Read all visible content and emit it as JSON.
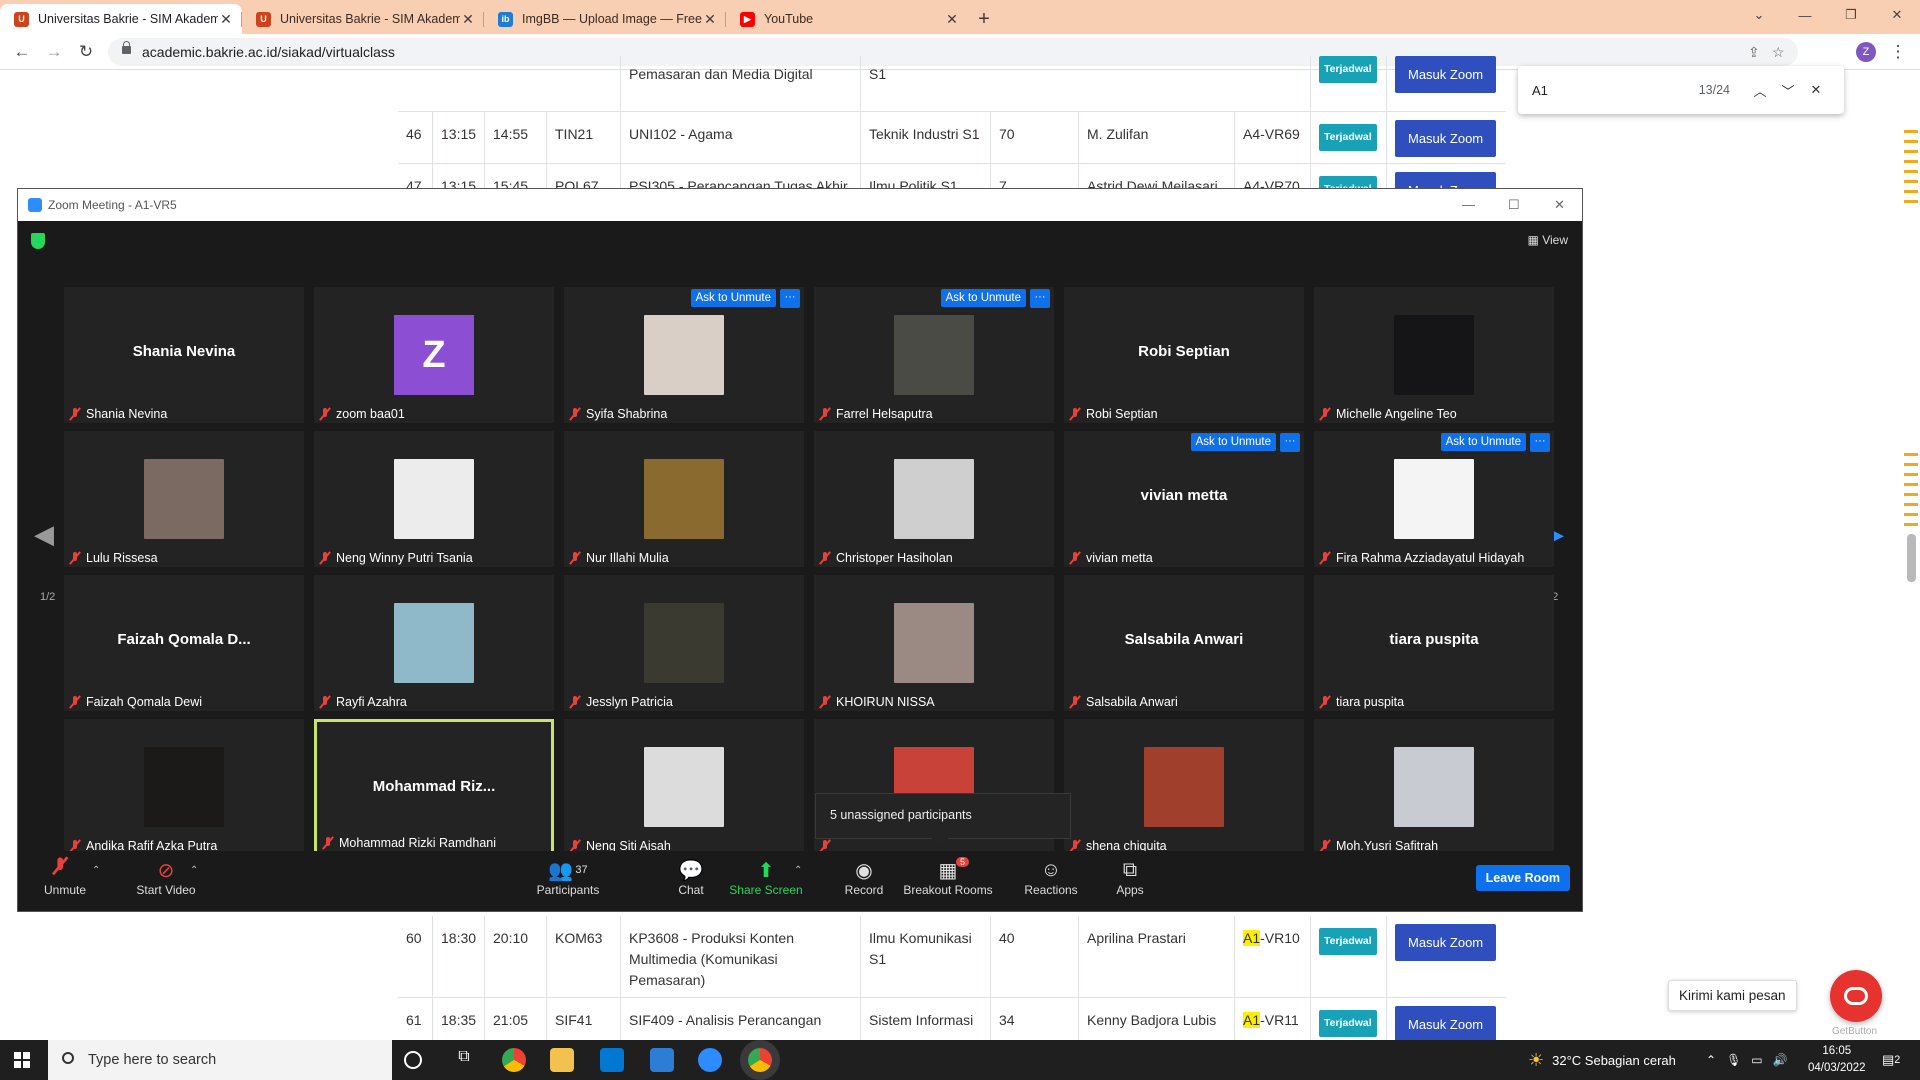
{
  "browser": {
    "tabs": [
      {
        "title": "Universitas Bakrie - SIM Akadem",
        "active": true
      },
      {
        "title": "Universitas Bakrie - SIM Akadem",
        "active": false
      },
      {
        "title": "ImgBB — Upload Image — Free",
        "active": false
      },
      {
        "title": "YouTube",
        "active": false
      }
    ],
    "url": "academic.bakrie.ac.id/siakad/virtualclass",
    "profile_initial": "Z"
  },
  "find": {
    "query": "A1",
    "count": "13/24"
  },
  "table": {
    "rows_top": [
      {
        "no": "46",
        "start": "13:15",
        "end": "14:55",
        "code": "TIN21",
        "course": "UNI102 - Agama",
        "prodi": "Teknik Industri S1",
        "qty": "70",
        "lecturer": "M. Zulifan",
        "room": "A4-VR69",
        "status": "Terjadwal",
        "action": "Masuk Zoom"
      },
      {
        "no": "47",
        "start": "13:15",
        "end": "15:45",
        "code": "POL67",
        "course": "PSI305 - Perancangan Tugas Akhir",
        "prodi": "Ilmu Politik S1",
        "qty": "7",
        "lecturer": "Astrid Dewi Meilasari",
        "room": "A4-VR70",
        "status": "Terjadwal",
        "action": "Masuk Zoom"
      }
    ],
    "partial_top": {
      "course_line2": "Pemasaran dan Media Digital",
      "prodi_line2": "S1",
      "action": "Masuk Zoom",
      "status": "Terjadwal"
    },
    "rows_bottom": [
      {
        "no": "60",
        "start": "18:30",
        "end": "20:10",
        "code": "KOM63",
        "course": "KP3608 - Produksi Konten Multimedia (Komunikasi Pemasaran)",
        "prodi": "Ilmu Komunikasi S1",
        "qty": "40",
        "lecturer": "Aprilina Prastari",
        "room_hl": "A1",
        "room_rest": "-VR10",
        "status": "Terjadwal",
        "action": "Masuk Zoom"
      },
      {
        "no": "61",
        "start": "18:35",
        "end": "21:05",
        "code": "SIF41",
        "course": "SIF409 - Analisis Perancangan",
        "prodi": "Sistem Informasi",
        "qty": "34",
        "lecturer": "Kenny Badjora Lubis",
        "room_hl": "A1",
        "room_rest": "-VR11",
        "status": "Terjadwal",
        "action": "Masuk Zoom"
      }
    ]
  },
  "zoom": {
    "title": "Zoom Meeting - A1-VR5",
    "view_label": "View",
    "ask_to_unmute": "Ask to Unmute",
    "more": "···",
    "page_indicator": "1/2",
    "participants": [
      {
        "name": "Shania Nevina",
        "display": "Shania Nevina",
        "kind": "text"
      },
      {
        "name": "zoom baa01",
        "display": "Z",
        "kind": "avatar"
      },
      {
        "name": "Syifa Shabrina",
        "kind": "photo",
        "color": "#d9cfc6",
        "ask": true
      },
      {
        "name": "Farrel Helsaputra",
        "kind": "photo",
        "color": "#4b4b46",
        "ask": true
      },
      {
        "name": "Robi Septian",
        "display": "Robi Septian",
        "kind": "text"
      },
      {
        "name": "Michelle Angeline Teo",
        "kind": "photo",
        "color": "#151517"
      },
      {
        "name": "Lulu Rissesa",
        "kind": "photo",
        "color": "#7a6a62"
      },
      {
        "name": "Neng Winny Putri Tsania",
        "kind": "photo",
        "color": "#ececec"
      },
      {
        "name": "Nur Illahi Mulia",
        "kind": "photo",
        "color": "#8a6a2f"
      },
      {
        "name": "Christoper Hasiholan",
        "kind": "photo",
        "color": "#cfcfcf"
      },
      {
        "name": "vivian metta",
        "display": "vivian metta",
        "kind": "text",
        "ask": true
      },
      {
        "name": "Fira Rahma Azziadayatul Hidayah",
        "kind": "photo",
        "color": "#f4f4f4",
        "ask": true
      },
      {
        "name": "Faizah Qomala Dewi",
        "display": "Faizah Qomala D...",
        "kind": "text"
      },
      {
        "name": "Rayfi Azahra",
        "kind": "photo",
        "color": "#8fb8c9"
      },
      {
        "name": "Jesslyn Patricia",
        "kind": "photo",
        "color": "#3a3a30"
      },
      {
        "name": "KHOIRUN NISSA",
        "kind": "photo",
        "color": "#9a8a83"
      },
      {
        "name": "Salsabila Anwari",
        "display": "Salsabila Anwari",
        "kind": "text"
      },
      {
        "name": "tiara puspita",
        "display": "tiara puspita",
        "kind": "text"
      },
      {
        "name": "Andika Rafif Azka Putra",
        "kind": "photo",
        "color": "#1c1a18"
      },
      {
        "name": "Mohammad Rizki Ramdhani",
        "display": "Mohammad  Riz...",
        "kind": "text",
        "active": true
      },
      {
        "name": "Neng Siti Aisah",
        "kind": "photo",
        "color": "#dcdcdc"
      },
      {
        "name": "",
        "kind": "photo",
        "color": "#c9423a"
      },
      {
        "name": "shena chiquita",
        "kind": "photo",
        "color": "#a0402c"
      },
      {
        "name": "Moh.Yusri Safitrah",
        "kind": "photo",
        "color": "#c8ccd2"
      }
    ],
    "popup": "5 unassigned participants",
    "toolbar": {
      "unmute": "Unmute",
      "start_video": "Start Video",
      "participants": "Participants",
      "participants_count": "37",
      "chat": "Chat",
      "share_screen": "Share Screen",
      "record": "Record",
      "breakout_rooms": "Breakout Rooms",
      "breakout_count": "5",
      "reactions": "Reactions",
      "apps": "Apps",
      "leave": "Leave Room"
    }
  },
  "chat_widget": {
    "message": "Kirimi kami pesan",
    "brand": "GetButton"
  },
  "taskbar": {
    "search_placeholder": "Type here to search",
    "weather": "32°C  Sebagian cerah",
    "time": "16:05",
    "date": "04/03/2022",
    "notifications": "2"
  }
}
